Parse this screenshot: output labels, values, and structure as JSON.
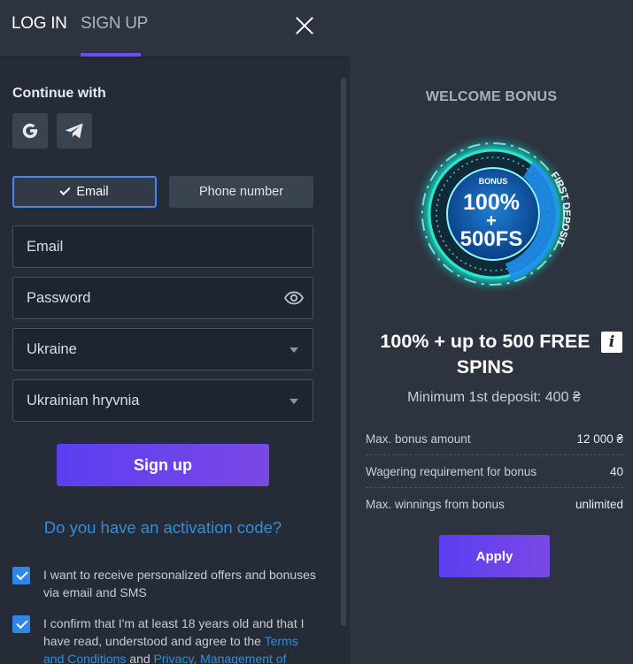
{
  "tabs": {
    "login": "LOG IN",
    "signup": "SIGN UP"
  },
  "continue_with": "Continue with",
  "social": [
    {
      "icon": "google-icon"
    },
    {
      "icon": "telegram-icon"
    }
  ],
  "method_toggle": {
    "email": "Email",
    "phone": "Phone number",
    "selected": "email"
  },
  "form": {
    "email_placeholder": "Email",
    "password_placeholder": "Password",
    "country_value": "Ukraine",
    "currency_value": "Ukrainian hryvnia"
  },
  "signup_button": "Sign up",
  "activation_link": "Do you have an activation code?",
  "checkboxes": {
    "offers": {
      "checked": true,
      "text": "I want to receive personalized offers and bonuses via email and SMS"
    },
    "terms": {
      "checked": true,
      "text_before": "I confirm that I'm at least 18 years old and that I have read, understood and agree to the ",
      "link1": "Terms and Conditions",
      "text_mid": " and ",
      "link2": "Privacy, Management of"
    }
  },
  "bonus": {
    "title": "WELCOME BONUS",
    "badge": {
      "top": "BONUS",
      "line1": "100%",
      "plus": "+",
      "line2": "500FS",
      "ring": "FIRST DEPOSIT"
    },
    "headline": "100% + up to 500 FREE SPINS",
    "min_deposit": "Minimum 1st deposit: 400 ₴",
    "details": [
      {
        "label": "Max. bonus amount",
        "value": "12 000 ₴"
      },
      {
        "label": "Wagering requirement for bonus",
        "value": "40"
      },
      {
        "label": "Max. winnings from bonus",
        "value": "unlimited"
      }
    ],
    "apply_button": "Apply"
  },
  "colors": {
    "accent": "#6a4df3",
    "link": "#2d8fe0",
    "checkbox": "#2f86e4",
    "badge_glow": "#2ee6c8"
  }
}
